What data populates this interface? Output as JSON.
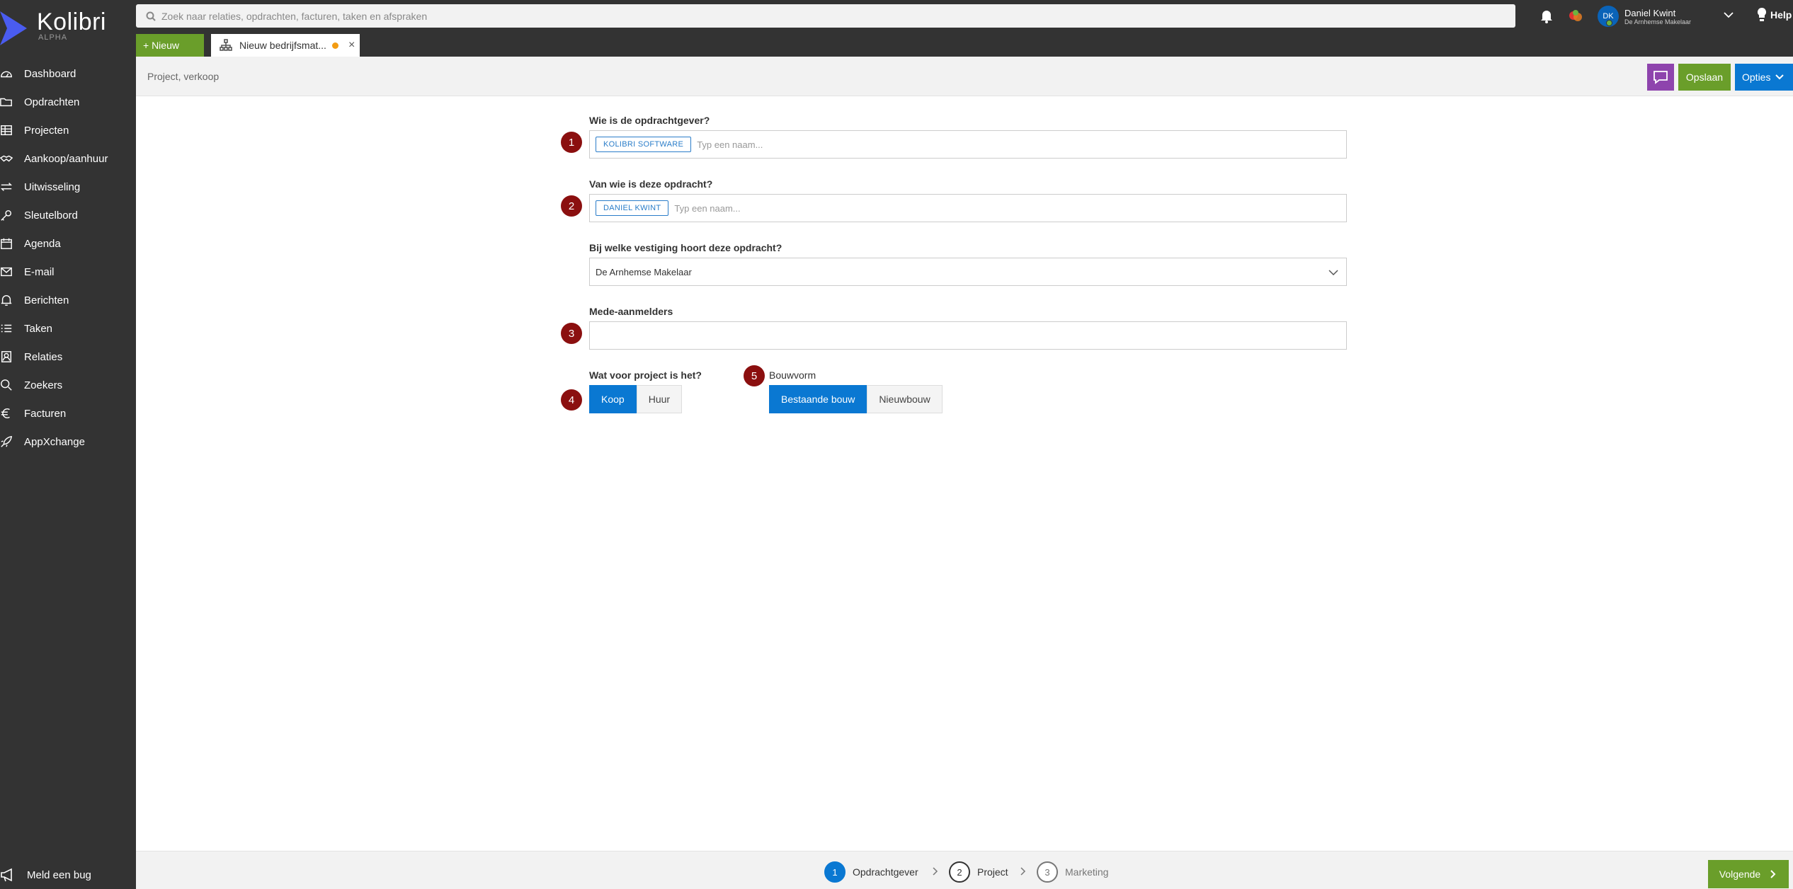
{
  "app": {
    "name": "Kolibri",
    "edition": "ALPHA",
    "colors": {
      "sidebar": "#333333",
      "primary": "#0a78d2",
      "success": "#6a9e2a",
      "chat": "#8e44ad",
      "badge": "#8b0f0f"
    }
  },
  "search": {
    "placeholder": "Zoek naar relaties, opdrachten, facturen, taken en afspraken"
  },
  "user": {
    "initials": "DK",
    "name": "Daniel Kwint",
    "org": "De Arnhemse Makelaar"
  },
  "help_label": "Help",
  "tabs": {
    "new_label": "+ Nieuw",
    "doc_title": "Nieuw bedrijfsmat...",
    "close": "×"
  },
  "sidebar": {
    "items": [
      {
        "label": "Dashboard",
        "icon": "dashboard-icon"
      },
      {
        "label": "Opdrachten",
        "icon": "folder-icon"
      },
      {
        "label": "Projecten",
        "icon": "projects-icon"
      },
      {
        "label": "Aankoop/aanhuur",
        "icon": "handshake-icon"
      },
      {
        "label": "Uitwisseling",
        "icon": "exchange-icon"
      },
      {
        "label": "Sleutelbord",
        "icon": "key-icon"
      },
      {
        "label": "Agenda",
        "icon": "calendar-icon"
      },
      {
        "label": "E-mail",
        "icon": "mail-icon"
      },
      {
        "label": "Berichten",
        "icon": "bell-icon"
      },
      {
        "label": "Taken",
        "icon": "tasks-icon"
      },
      {
        "label": "Relaties",
        "icon": "contacts-icon"
      },
      {
        "label": "Zoekers",
        "icon": "search-icon"
      },
      {
        "label": "Facturen",
        "icon": "euro-icon"
      },
      {
        "label": "AppXchange",
        "icon": "rocket-icon"
      }
    ],
    "bug_label": "Meld een bug"
  },
  "subheader": {
    "breadcrumb": "Project, verkoop",
    "save_label": "Opslaan",
    "options_label": "Opties"
  },
  "form": {
    "q1": {
      "badge": "1",
      "label": "Wie is de opdrachtgever?",
      "chip": "KOLIBRI SOFTWARE",
      "placeholder": "Typ een naam..."
    },
    "q2": {
      "badge": "2",
      "label": "Van wie is deze opdracht?",
      "chip": "DANIEL KWINT",
      "placeholder": "Typ een naam..."
    },
    "q_branch": {
      "label": "Bij welke vestiging hoort deze opdracht?",
      "value": "De Arnhemse Makelaar"
    },
    "q3": {
      "badge": "3",
      "label": "Mede-aanmelders",
      "value": ""
    },
    "q4": {
      "badge": "4",
      "label": "Wat voor project is het?",
      "options": [
        "Koop",
        "Huur"
      ],
      "selected": "Koop"
    },
    "q5": {
      "badge": "5",
      "label": "Bouwvorm",
      "options": [
        "Bestaande bouw",
        "Nieuwbouw"
      ],
      "selected": "Bestaande bouw"
    }
  },
  "wizard": {
    "steps": [
      {
        "num": "1",
        "label": "Opdrachtgever",
        "state": "active"
      },
      {
        "num": "2",
        "label": "Project",
        "state": "next"
      },
      {
        "num": "3",
        "label": "Marketing",
        "state": "pending"
      }
    ],
    "next_label": "Volgende"
  }
}
